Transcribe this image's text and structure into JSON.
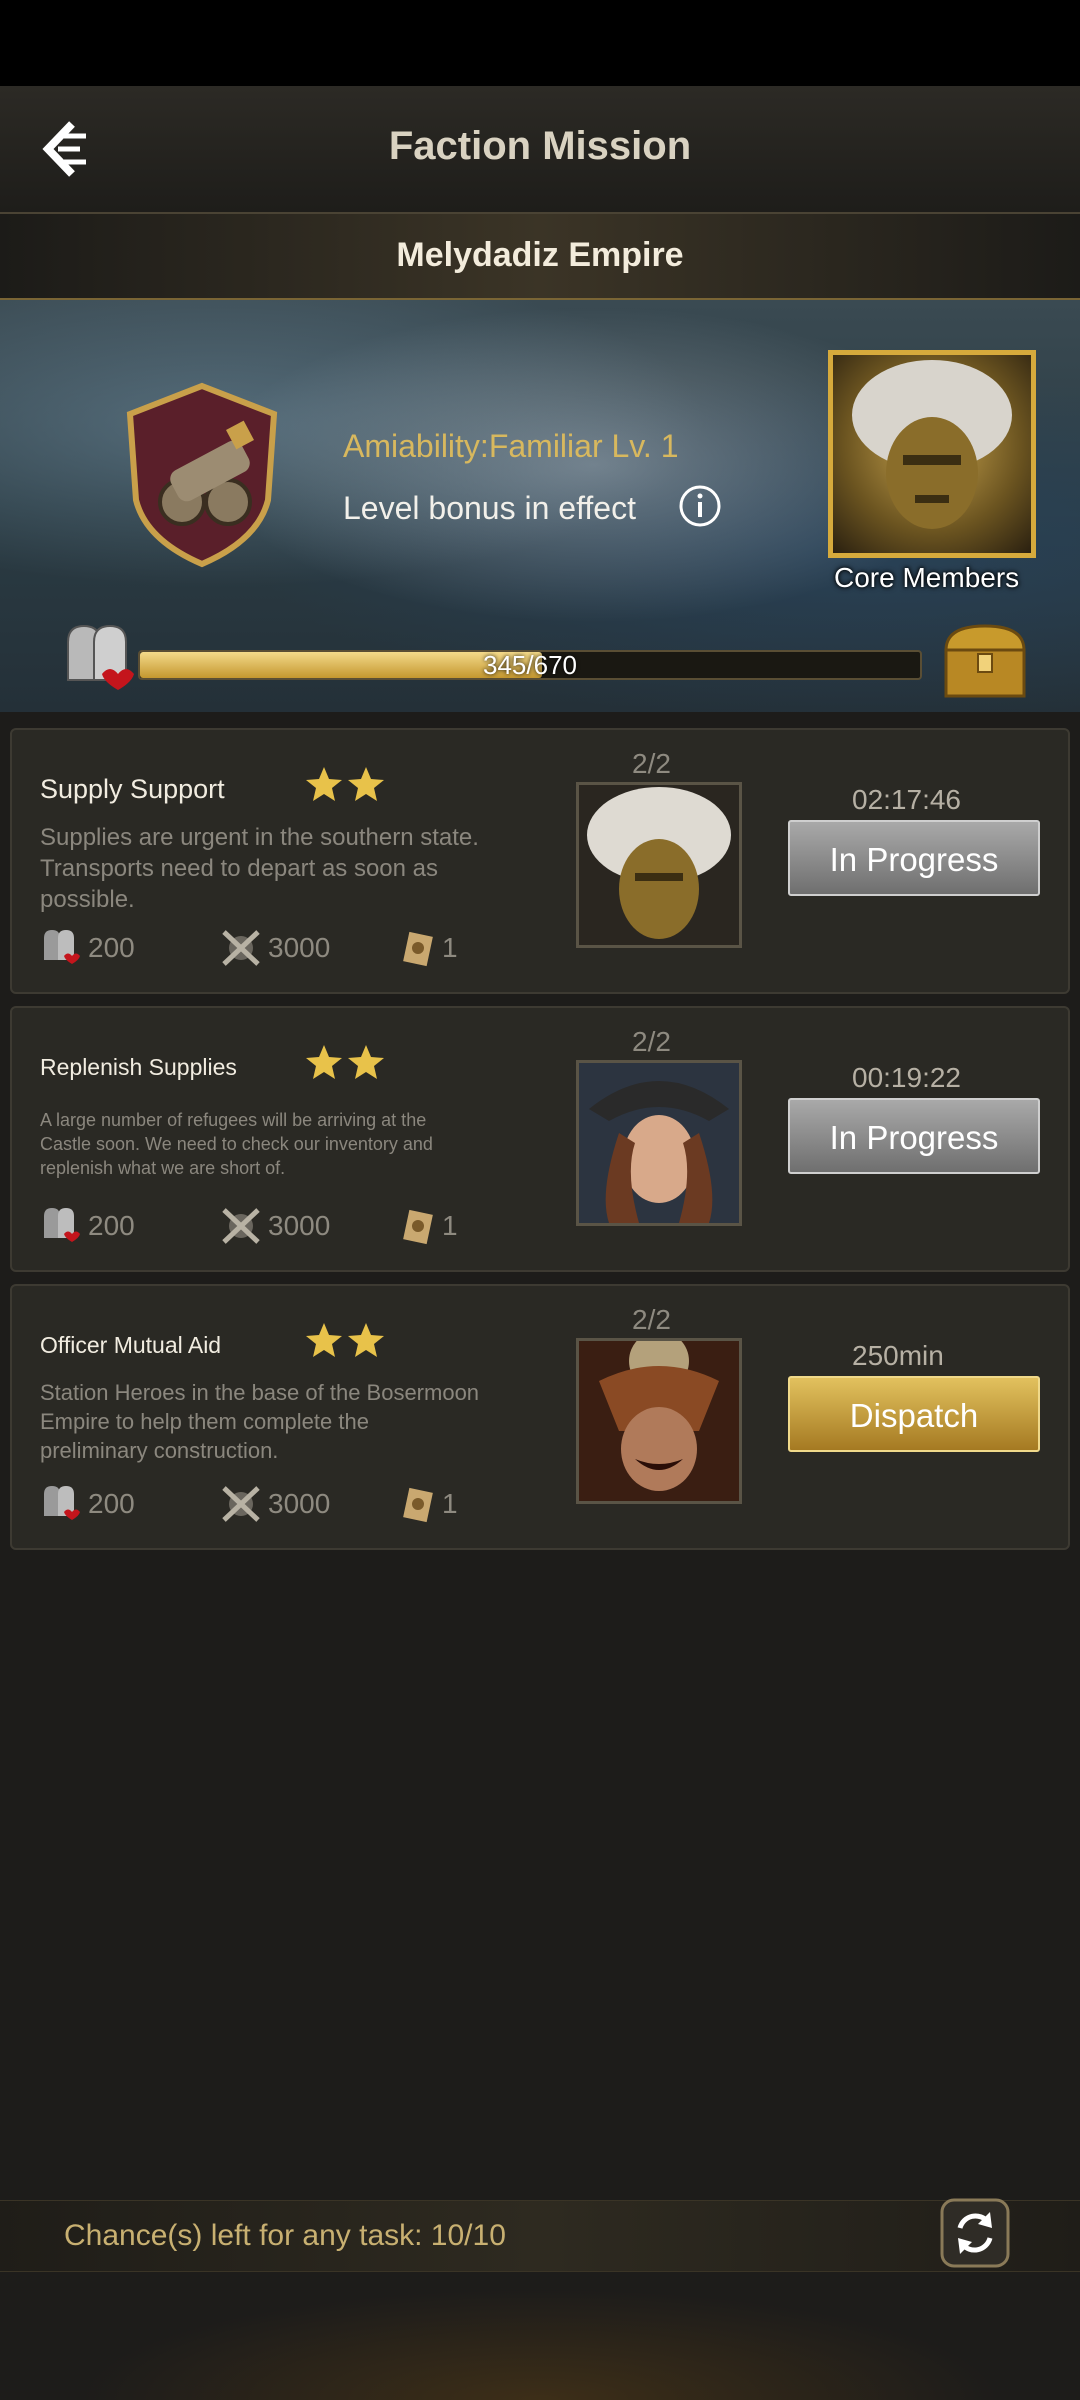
{
  "header": {
    "title": "Faction Mission"
  },
  "faction": {
    "name": "Melydadiz Empire"
  },
  "banner": {
    "amiability": "Amiability:Familiar Lv. 1",
    "level_bonus": "Level bonus in effect",
    "core_members_label": "Core Members",
    "progress_text": "345/670",
    "progress_value": 0.515
  },
  "missions": [
    {
      "title": "Supply Support",
      "stars": 2,
      "description": "Supplies are urgent in the southern state. Transports need to depart as soon as possible.",
      "reward_reputation": "200",
      "reward_exp": "3000",
      "reward_scroll": "1",
      "count": "2/2",
      "timer": "02:17:46",
      "button": "In Progress"
    },
    {
      "title": "Replenish Supplies",
      "stars": 2,
      "description": "A large number of refugees will be arriving at the Castle soon. We need to check our inventory and replenish what we are short of.",
      "reward_reputation": "200",
      "reward_exp": "3000",
      "reward_scroll": "1",
      "count": "2/2",
      "timer": "00:19:22",
      "button": "In Progress"
    },
    {
      "title": "Officer Mutual Aid",
      "stars": 2,
      "description": "Station Heroes in the base of the Bosermoon Empire to help them complete the preliminary construction.",
      "reward_reputation": "200",
      "reward_exp": "3000",
      "reward_scroll": "1",
      "count": "2/2",
      "timer": "250min",
      "button": "Dispatch"
    }
  ],
  "footer": {
    "chances_text": "Chance(s) left for any task: 10/10"
  },
  "colors": {
    "accent_gold": "#d6aa3c",
    "button_grey": "#8c8c8c",
    "button_gold": "#c49a3a"
  }
}
